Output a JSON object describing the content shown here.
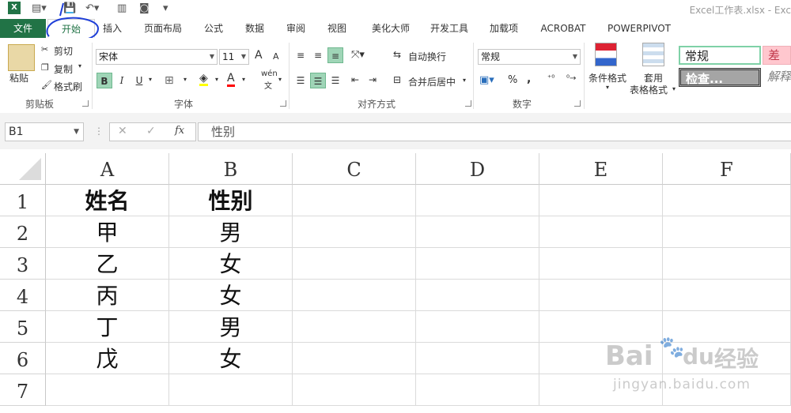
{
  "window": {
    "title": "Excel工作表.xlsx - Exc"
  },
  "tabs": [
    {
      "label": "文件"
    },
    {
      "label": "开始"
    },
    {
      "label": "插入"
    },
    {
      "label": "页面布局"
    },
    {
      "label": "公式"
    },
    {
      "label": "数据"
    },
    {
      "label": "审阅"
    },
    {
      "label": "视图"
    },
    {
      "label": "美化大师"
    },
    {
      "label": "开发工具"
    },
    {
      "label": "加载项"
    },
    {
      "label": "ACROBAT"
    },
    {
      "label": "POWERPIVOT"
    }
  ],
  "ribbon": {
    "clipboard": {
      "paste": "粘贴",
      "cut": "剪切",
      "copy": "复制",
      "format_painter": "格式刷",
      "group": "剪贴板"
    },
    "font": {
      "name": "宋体",
      "size": "11",
      "bold": "B",
      "italic": "I",
      "underline": "U",
      "grow": "A",
      "shrink": "A",
      "color_a": "A",
      "phonetic": "wén",
      "phonetic_sub": "文",
      "group": "字体"
    },
    "alignment": {
      "wrap": "自动换行",
      "merge": "合并后居中",
      "group": "对齐方式"
    },
    "number": {
      "format": "常规",
      "percent": "%",
      "comma": ",",
      "group": "数字"
    },
    "styles": {
      "conditional": "条件格式",
      "table_format_1": "套用",
      "table_format_2": "表格格式",
      "normal": "常规",
      "bad": "差",
      "check": "检查...",
      "explain": "解释"
    }
  },
  "formula_bar": {
    "name_box": "B1",
    "cancel": "✕",
    "enter": "✓",
    "fx": "fx",
    "value": "性别"
  },
  "sheet": {
    "columns": [
      "A",
      "B",
      "C",
      "D",
      "E",
      "F"
    ],
    "rows": [
      "1",
      "2",
      "3",
      "4",
      "5",
      "6",
      "7"
    ],
    "cells": [
      [
        "姓名",
        "性别"
      ],
      [
        "甲",
        "男"
      ],
      [
        "乙",
        "女"
      ],
      [
        "丙",
        "女"
      ],
      [
        "丁",
        "男"
      ],
      [
        "戊",
        "女"
      ]
    ]
  },
  "colors": {
    "accent": "#217346",
    "active_button": "#9fd5b7",
    "bad_style": "#ffc7ce",
    "check_style": "#a5a5a5"
  },
  "watermark": {
    "brand": "Bai",
    "brand2": "du",
    "text": "经验",
    "url": "jingyan.baidu.com"
  }
}
